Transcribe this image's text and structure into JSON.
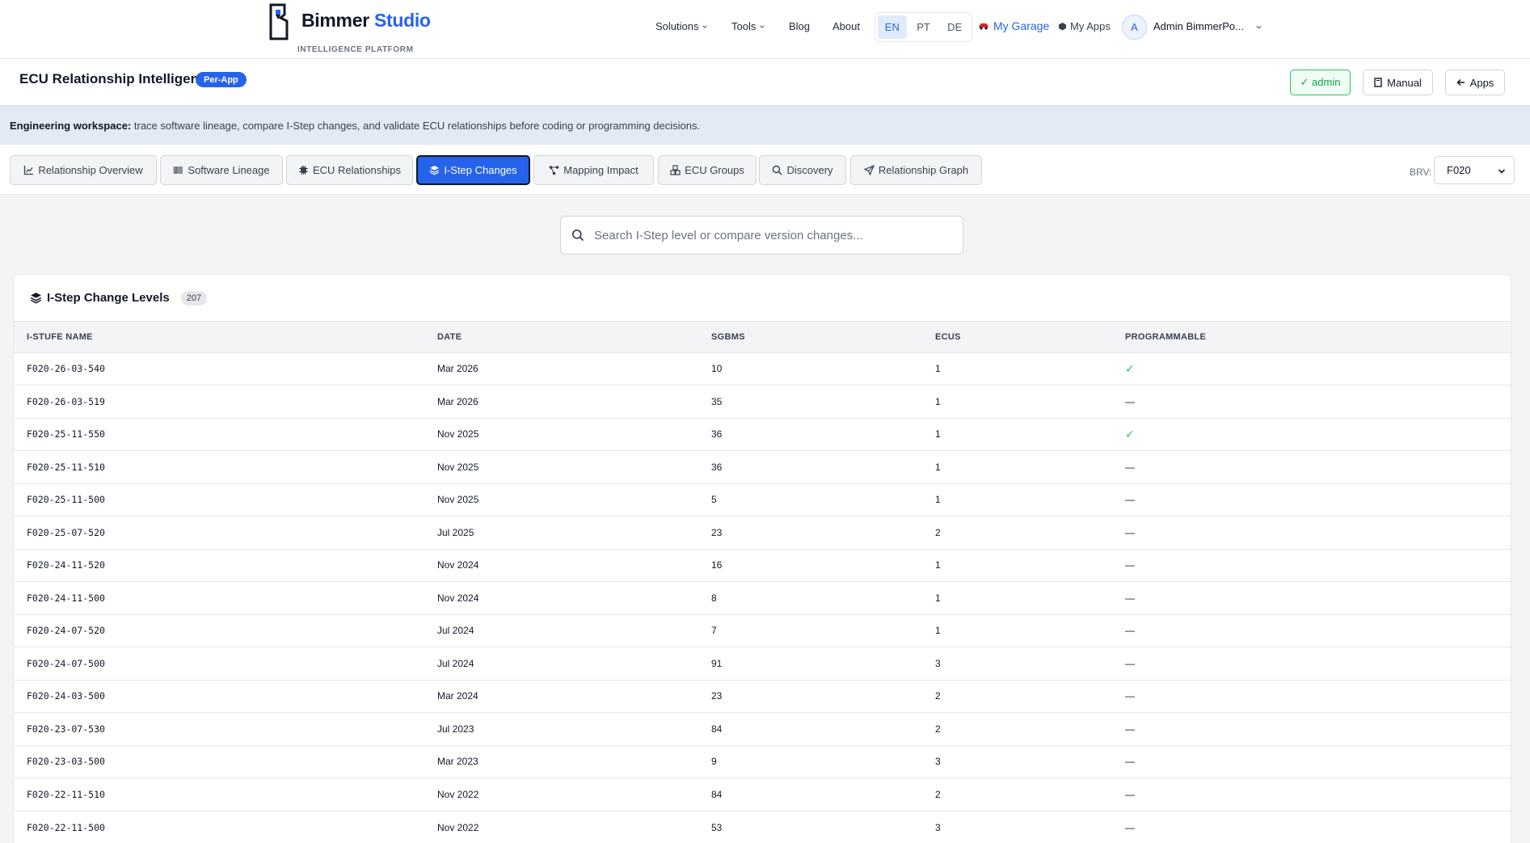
{
  "brand": {
    "name_main": "Bimmer",
    "name_accent": "Studio",
    "tagline": "INTELLIGENCE PLATFORM"
  },
  "nav": {
    "items": [
      {
        "label": "Solutions",
        "dropdown": true
      },
      {
        "label": "Tools",
        "dropdown": true
      },
      {
        "label": "Blog",
        "dropdown": false
      },
      {
        "label": "About",
        "dropdown": false
      }
    ],
    "languages": [
      "EN",
      "PT",
      "DE"
    ],
    "active_language": "EN",
    "garage_label": "My Garage",
    "myapps_label": "My Apps",
    "avatar_initial": "A",
    "username": "Admin BimmerPo..."
  },
  "header": {
    "title": "ECU Relationship Intelligence",
    "badge": "Per-App",
    "admin_label": "✓ admin",
    "manual_label": "Manual",
    "apps_label": "Apps"
  },
  "banner": {
    "lead": "Engineering workspace:",
    "text": " trace software lineage, compare I-Step changes, and validate ECU relationships before coding or programming decisions."
  },
  "tabs": [
    {
      "label": "Relationship Overview",
      "icon": "chart-line-icon"
    },
    {
      "label": "Software Lineage",
      "icon": "barcode-icon"
    },
    {
      "label": "ECU Relationships",
      "icon": "microchip-icon"
    },
    {
      "label": "I-Step Changes",
      "icon": "layers-icon",
      "active": true
    },
    {
      "label": "Mapping Impact",
      "icon": "nodes-icon"
    },
    {
      "label": "ECU Groups",
      "icon": "cubes-icon"
    },
    {
      "label": "Discovery",
      "icon": "search-icon"
    },
    {
      "label": "Relationship Graph",
      "icon": "send-icon"
    }
  ],
  "brv": {
    "label": "BRV:",
    "value": "F020"
  },
  "search": {
    "placeholder": "Search I-Step level or compare version changes..."
  },
  "table": {
    "title": "I-Step Change Levels",
    "count": "207",
    "columns": [
      "I-STUFE NAME",
      "DATE",
      "SGBMS",
      "ECUS",
      "PROGRAMMABLE"
    ],
    "rows": [
      [
        "F020-26-03-540",
        "Mar 2026",
        "10",
        "1",
        "✓"
      ],
      [
        "F020-26-03-519",
        "Mar 2026",
        "35",
        "1",
        "—"
      ],
      [
        "F020-25-11-550",
        "Nov 2025",
        "36",
        "1",
        "✓"
      ],
      [
        "F020-25-11-510",
        "Nov 2025",
        "36",
        "1",
        "—"
      ],
      [
        "F020-25-11-500",
        "Nov 2025",
        "5",
        "1",
        "—"
      ],
      [
        "F020-25-07-520",
        "Jul 2025",
        "23",
        "2",
        "—"
      ],
      [
        "F020-24-11-520",
        "Nov 2024",
        "16",
        "1",
        "—"
      ],
      [
        "F020-24-11-500",
        "Nov 2024",
        "8",
        "1",
        "—"
      ],
      [
        "F020-24-07-520",
        "Jul 2024",
        "7",
        "1",
        "—"
      ],
      [
        "F020-24-07-500",
        "Jul 2024",
        "91",
        "3",
        "—"
      ],
      [
        "F020-24-03-500",
        "Mar 2024",
        "23",
        "2",
        "—"
      ],
      [
        "F020-23-07-530",
        "Jul 2023",
        "84",
        "2",
        "—"
      ],
      [
        "F020-23-03-500",
        "Mar 2023",
        "9",
        "3",
        "—"
      ],
      [
        "F020-22-11-510",
        "Nov 2022",
        "84",
        "2",
        "—"
      ],
      [
        "F020-22-11-500",
        "Nov 2022",
        "53",
        "3",
        "—"
      ]
    ]
  },
  "colors": {
    "accent": "#2563eb",
    "success": "#22c55e",
    "banner_bg": "#e3eaf5"
  }
}
